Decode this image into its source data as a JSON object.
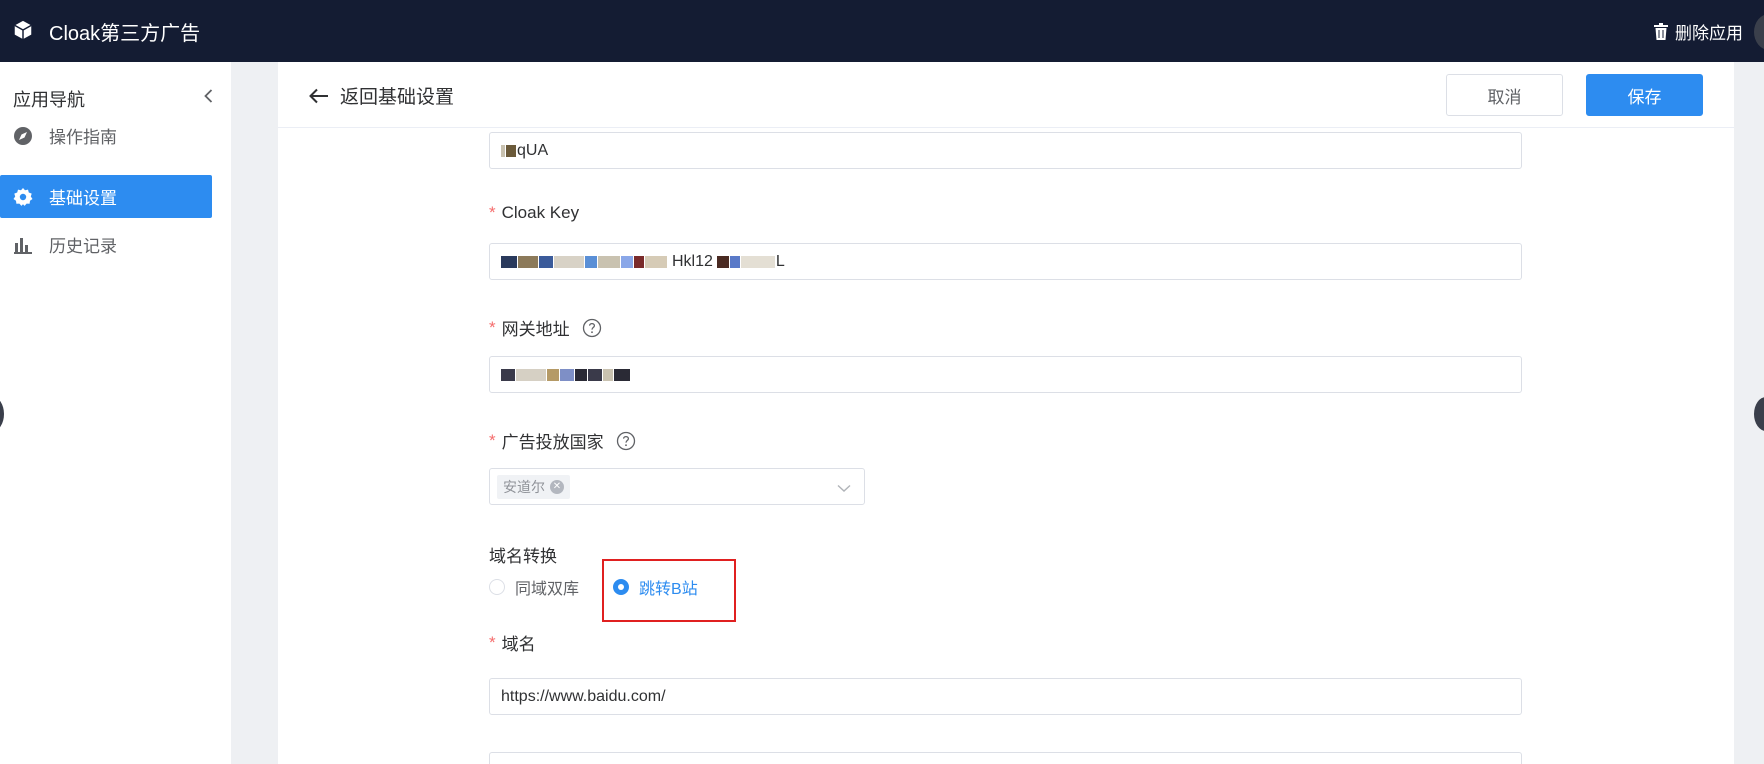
{
  "topbar": {
    "app_title": "Cloak第三方广告",
    "delete_app_label": "删除应用"
  },
  "sidebar": {
    "title": "应用导航",
    "items": [
      {
        "label": "操作指南",
        "icon": "compass-icon",
        "active": false
      },
      {
        "label": "基础设置",
        "icon": "gear-icon",
        "active": true
      },
      {
        "label": "历史记录",
        "icon": "bar-chart-icon",
        "active": false
      }
    ]
  },
  "header": {
    "back_label": "返回基础设置",
    "cancel_label": "取消",
    "save_label": "保存"
  },
  "form": {
    "top_field_value": "qUA",
    "cloak_key": {
      "label": "Cloak Key",
      "required": true,
      "visible_fragments": [
        "Hkl12",
        "L"
      ]
    },
    "gateway": {
      "label": "网关地址",
      "required": true
    },
    "country": {
      "label": "广告投放国家",
      "required": true,
      "tags": [
        "安道尔"
      ]
    },
    "domain_conversion": {
      "label": "域名转换",
      "options": [
        "同域双库",
        "跳转B站"
      ],
      "selected": "跳转B站"
    },
    "domain": {
      "label": "域名",
      "required": true,
      "value": "https://www.baidu.com/"
    },
    "required_mark": "*"
  },
  "colors": {
    "topbar_bg": "#141c33",
    "accent": "#2d8cf0",
    "required": "#f56c6c",
    "highlight": "#e02020"
  }
}
